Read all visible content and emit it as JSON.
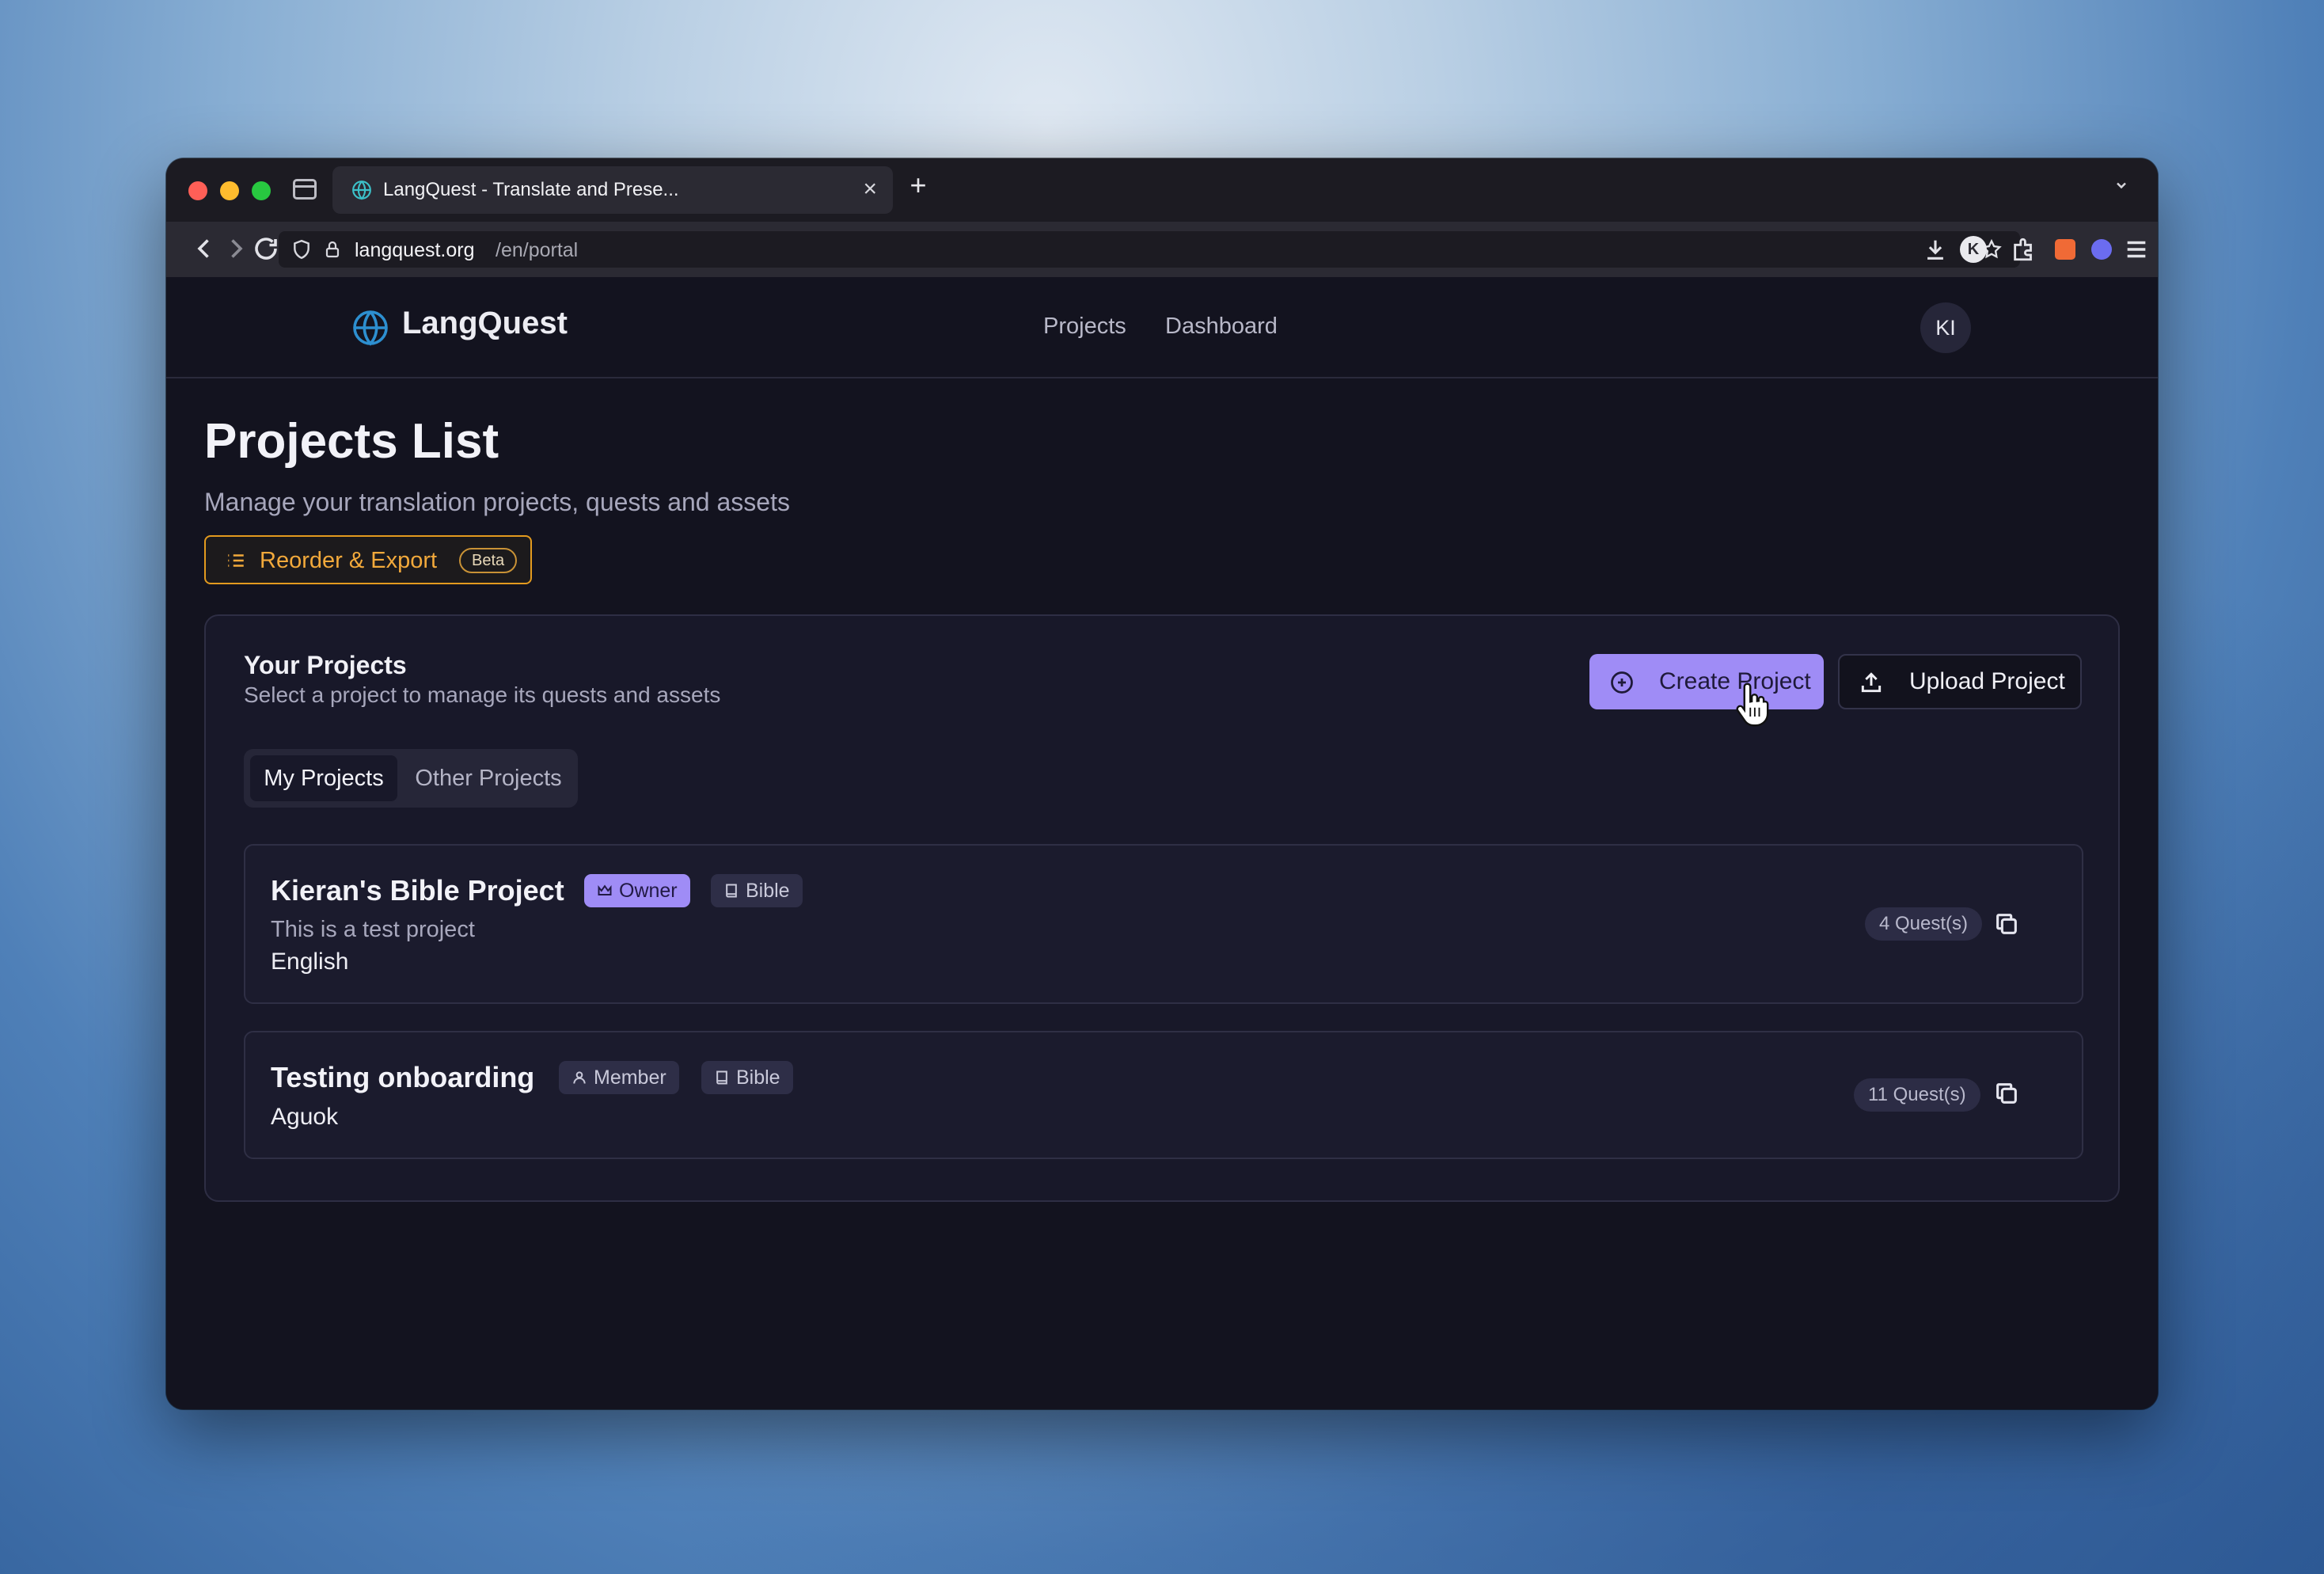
{
  "browser": {
    "tab_title": "LangQuest - Translate and Prese...",
    "new_tab": "+",
    "url_host": "langquest.org",
    "url_path": "/en/portal",
    "profile_initial": "K"
  },
  "header": {
    "brand": "LangQuest",
    "nav": [
      "Projects",
      "Dashboard"
    ],
    "user_initials": "KI"
  },
  "page": {
    "title": "Projects List",
    "subtitle": "Manage your translation projects, quests and assets",
    "reorder_label": "Reorder & Export",
    "beta_label": "Beta"
  },
  "card": {
    "title": "Your Projects",
    "description": "Select a project to manage its quests and assets",
    "create_label": "Create Project",
    "upload_label": "Upload Project",
    "tabs": [
      "My Projects",
      "Other Projects"
    ],
    "active_tab": "My Projects"
  },
  "projects": [
    {
      "name": "Kieran's Bible Project",
      "role": "Owner",
      "type": "Bible",
      "description": "This is a test project",
      "language": "English",
      "quests": "4 Quest(s)"
    },
    {
      "name": "Testing onboarding",
      "role": "Member",
      "type": "Bible",
      "language": "Aguok",
      "quests": "11 Quest(s)"
    }
  ],
  "colors": {
    "accent": "#9f8cf6",
    "warning": "#e39a1f",
    "background": "#13131f",
    "brand_globe": "#2d8fd0"
  },
  "icons": [
    "globe-icon",
    "list-icon",
    "plus-circle-icon",
    "upload-icon",
    "crown-icon",
    "user-icon",
    "book-icon",
    "copy-icon",
    "hand-cursor-icon"
  ]
}
